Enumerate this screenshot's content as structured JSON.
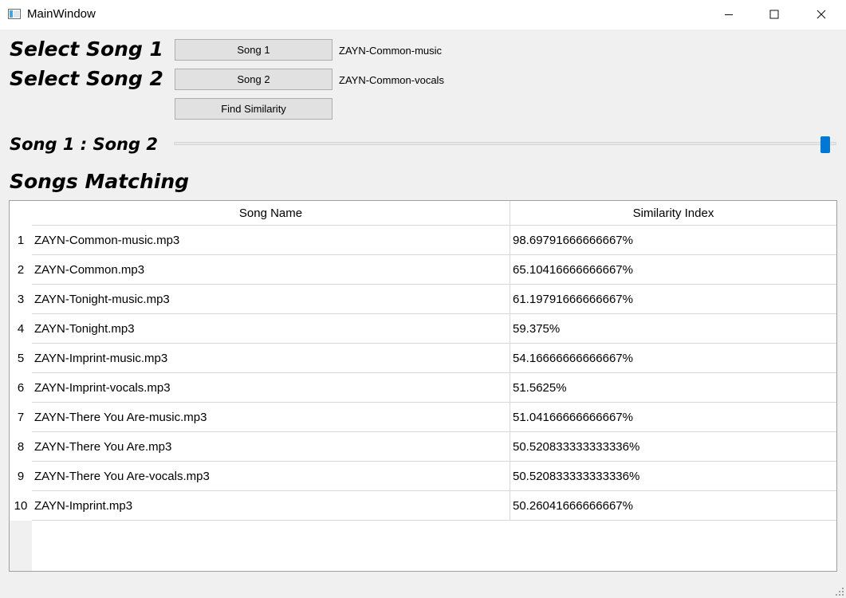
{
  "window": {
    "title": "MainWindow",
    "controls": [
      "minimize-icon",
      "maximize-icon",
      "close-icon"
    ]
  },
  "labels": {
    "select_song_1": "Select Song 1",
    "select_song_2": "Select Song 2",
    "ratio": "Song 1 : Song 2",
    "matching": "Songs Matching"
  },
  "buttons": {
    "song1": "Song 1",
    "song2": "Song 2",
    "find": "Find Similarity"
  },
  "files": {
    "song1": "ZAYN-Common-music",
    "song2": "ZAYN-Common-vocals"
  },
  "slider": {
    "fraction": 1.0,
    "accent": "#0078d7"
  },
  "table": {
    "headers": [
      "Song Name",
      "Similarity Index"
    ],
    "rows": [
      {
        "num": "1",
        "name": "ZAYN-Common-music.mp3",
        "sim": "98.69791666666667%"
      },
      {
        "num": "2",
        "name": "ZAYN-Common.mp3",
        "sim": "65.10416666666667%"
      },
      {
        "num": "3",
        "name": "ZAYN-Tonight-music.mp3",
        "sim": "61.19791666666667%"
      },
      {
        "num": "4",
        "name": "ZAYN-Tonight.mp3",
        "sim": "59.375%"
      },
      {
        "num": "5",
        "name": "ZAYN-Imprint-music.mp3",
        "sim": "54.16666666666667%"
      },
      {
        "num": "6",
        "name": "ZAYN-Imprint-vocals.mp3",
        "sim": "51.5625%"
      },
      {
        "num": "7",
        "name": "ZAYN-There You Are-music.mp3",
        "sim": "51.04166666666667%"
      },
      {
        "num": "8",
        "name": "ZAYN-There You Are.mp3",
        "sim": "50.520833333333336%"
      },
      {
        "num": "9",
        "name": "ZAYN-There You Are-vocals.mp3",
        "sim": "50.520833333333336%"
      },
      {
        "num": "10",
        "name": "ZAYN-Imprint.mp3",
        "sim": "50.26041666666667%"
      }
    ]
  }
}
